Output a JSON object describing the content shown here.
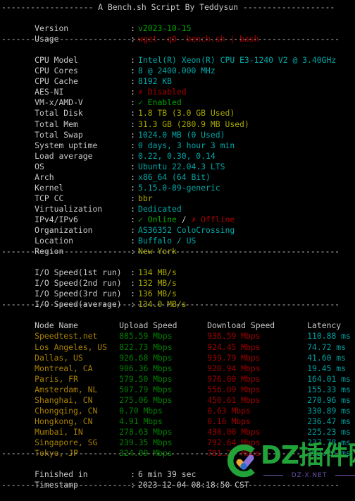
{
  "terminal": {
    "title_line": "------------------- A Bench.sh Script By Teddysun -------------------",
    "separator": "----------------------------------------------------------------------",
    "header_rows": [
      {
        "label": "Version",
        "value": "v2023-10-15",
        "color": "green"
      },
      {
        "label": "Usage",
        "value": "wget -qO- bench.sh | bash",
        "color": "red"
      }
    ],
    "system_rows": [
      {
        "label": "CPU Model",
        "value": "Intel(R) Xeon(R) CPU E3-1240 V2 @ 3.40GHz",
        "color": "cyan"
      },
      {
        "label": "CPU Cores",
        "value": "8 @ 2400.000 MHz",
        "color": "cyan"
      },
      {
        "label": "CPU Cache",
        "value": "8192 KB",
        "color": "cyan"
      },
      {
        "label": "AES-NI",
        "value": "✗ Disabled",
        "color": "red"
      },
      {
        "label": "VM-x/AMD-V",
        "value": "✓ Enabled",
        "color": "green"
      },
      {
        "label": "Total Disk",
        "value": "1.8 TB (3.0 GB Used)",
        "color": "yellow"
      },
      {
        "label": "Total Mem",
        "value": "31.3 GB (280.9 MB Used)",
        "color": "yellow"
      },
      {
        "label": "Total Swap",
        "value": "1024.0 MB (0 Used)",
        "color": "cyan"
      },
      {
        "label": "System uptime",
        "value": "0 days, 3 hour 3 min",
        "color": "cyan"
      },
      {
        "label": "Load average",
        "value": "0.22, 0.30, 0.14",
        "color": "cyan"
      },
      {
        "label": "OS",
        "value": "Ubuntu 22.04.3 LTS",
        "color": "cyan"
      },
      {
        "label": "Arch",
        "value": "x86_64 (64 Bit)",
        "color": "cyan"
      },
      {
        "label": "Kernel",
        "value": "5.15.0-89-generic",
        "color": "cyan"
      },
      {
        "label": "TCP CC",
        "value": "bbr",
        "color": "yellow"
      },
      {
        "label": "Virtualization",
        "value": "Dedicated",
        "color": "cyan"
      },
      {
        "label": "IPv4/IPv6",
        "value": "✓ Online / ✗ Offline",
        "color": "mixed"
      },
      {
        "label": "Organization",
        "value": "AS36352 ColoCrossing",
        "color": "cyan"
      },
      {
        "label": "Location",
        "value": "Buffalo / US",
        "color": "cyan"
      },
      {
        "label": "Region",
        "value": "New York",
        "color": "yellow"
      }
    ],
    "ipv4_ipv6": {
      "online_mark": "✓ Online",
      "slash": " / ",
      "offline_mark": "✗ Offline"
    },
    "io_rows": [
      {
        "label": "I/O Speed(1st run)",
        "value": "134 MB/s",
        "color": "yellow"
      },
      {
        "label": "I/O Speed(2nd run)",
        "value": "132 MB/s",
        "color": "yellow"
      },
      {
        "label": "I/O Speed(3rd run)",
        "value": "136 MB/s",
        "color": "yellow"
      },
      {
        "label": "I/O Speed(average)",
        "value": "134.0 MB/s",
        "color": "yellow"
      }
    ],
    "speedtest": {
      "columns": [
        "Node Name",
        "Upload Speed",
        "Download Speed",
        "Latency"
      ],
      "rows": [
        {
          "node": "Speedtest.net",
          "upload": "885.59 Mbps",
          "download": "936.59 Mbps",
          "latency": "110.88 ms"
        },
        {
          "node": "Los Angeles, US",
          "upload": "822.73 Mbps",
          "download": "924.45 Mbps",
          "latency": "74.72 ms"
        },
        {
          "node": "Dallas, US",
          "upload": "926.68 Mbps",
          "download": "939.79 Mbps",
          "latency": "41.60 ms"
        },
        {
          "node": "Montreal, CA",
          "upload": "906.36 Mbps",
          "download": "920.94 Mbps",
          "latency": "19.45 ms"
        },
        {
          "node": "Paris, FR",
          "upload": "579.50 Mbps",
          "download": "976.00 Mbps",
          "latency": "164.01 ms"
        },
        {
          "node": "Amsterdam, NL",
          "upload": "507.79 Mbps",
          "download": "556.09 Mbps",
          "latency": "155.33 ms"
        },
        {
          "node": "Shanghai, CN",
          "upload": "275.06 Mbps",
          "download": "450.61 Mbps",
          "latency": "270.96 ms"
        },
        {
          "node": "Chongqing, CN",
          "upload": "0.70 Mbps",
          "download": "0.63 Mbps",
          "latency": "330.89 ms"
        },
        {
          "node": "Hongkong, CN",
          "upload": "4.91 Mbps",
          "download": "0.16 Mbps",
          "latency": "236.47 ms"
        },
        {
          "node": "Mumbai, IN",
          "upload": "278.63 Mbps",
          "download": "430.00 Mbps",
          "latency": "225.23 ms"
        },
        {
          "node": "Singapore, SG",
          "upload": "239.35 Mbps",
          "download": "792.64 Mbps",
          "latency": "237.78 ms"
        },
        {
          "node": "Tokyo, JP",
          "upload": "324.09 Mbps",
          "download": "781.26 Mbps",
          "latency": "192.26 ms"
        }
      ]
    },
    "footer_rows": [
      {
        "label": "Finished in",
        "value": "6 min 39 sec",
        "color": "white"
      },
      {
        "label": "Timestamp",
        "value": "2023-12-04 08:18:50 CST",
        "color": "white"
      }
    ]
  },
  "watermark": {
    "brand": "DZ插件网",
    "domain": "DZ-X.NET",
    "logo_color": "#22a33a",
    "accent_orange": "#f0a830",
    "accent_purple": "#8a6fd6",
    "accent_blue": "#2a6fd0"
  }
}
